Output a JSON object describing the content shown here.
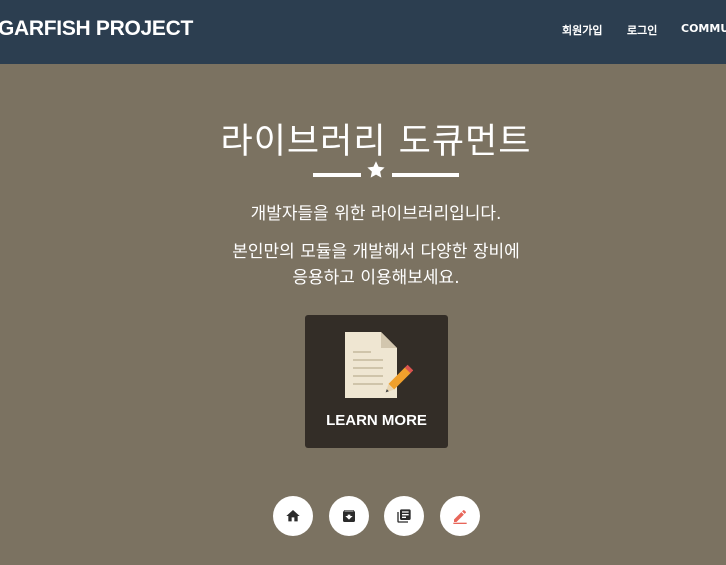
{
  "navbar": {
    "brand": "GARFISH PROJECT",
    "items": [
      {
        "label": "회원가입"
      },
      {
        "label": "로그인"
      },
      {
        "label": "COMMU"
      }
    ]
  },
  "hero": {
    "title": "라이브러리 도큐먼트",
    "subtitle_1": "개발자들을 위한 라이브러리입니다.",
    "subtitle_2": "본인만의 모듈을 개발해서 다양한 장비에",
    "subtitle_3": "응용하고 이용해보세요."
  },
  "learn_more": {
    "label": "LEARN MORE",
    "icon": "document-pencil-icon"
  },
  "quick_links": [
    {
      "icon": "home-icon"
    },
    {
      "icon": "archive-icon"
    },
    {
      "icon": "library-books-icon"
    },
    {
      "icon": "edit-icon",
      "color": "#e8665a"
    }
  ],
  "colors": {
    "navbar_bg": "#2c3e50",
    "page_bg": "#7b7261",
    "card_bg": "#332d27"
  }
}
